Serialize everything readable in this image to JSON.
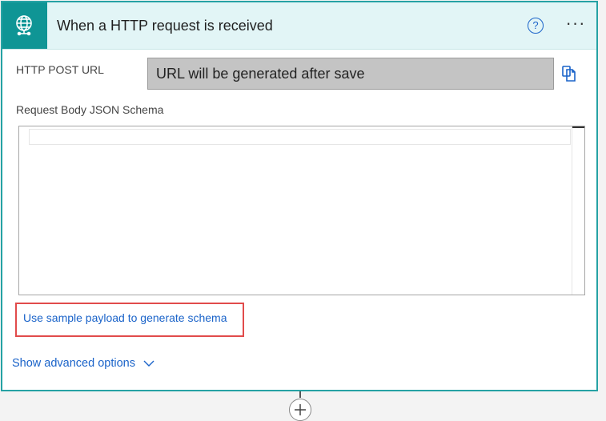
{
  "trigger": {
    "title": "When a HTTP request is received",
    "icon": "globe-request-icon",
    "help_label": "?",
    "more_label": "···",
    "accent_color": "#0f9595"
  },
  "fields": {
    "http_post_url_label": "HTTP POST URL",
    "http_post_url_value": "URL will be generated after save",
    "schema_label": "Request Body JSON Schema",
    "schema_value": ""
  },
  "links": {
    "sample_payload": "Use sample payload to generate schema",
    "show_advanced": "Show advanced options"
  }
}
